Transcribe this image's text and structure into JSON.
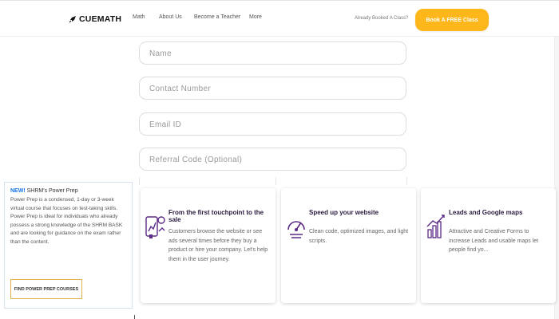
{
  "header": {
    "logo_text": "CUEMATH",
    "nav": [
      "Math",
      "About Us",
      "Become a Teacher",
      "More"
    ],
    "already_booked": "Already Booked A Class?",
    "book_button": "Book A FREE Class"
  },
  "form": {
    "name_placeholder": "Name",
    "contact_placeholder": "Contact Number",
    "email_placeholder": "Email ID",
    "referral_placeholder": "Referral Code (Optional)"
  },
  "promo": {
    "new_label": "NEW!",
    "title": " SHRM's Power Prep",
    "body": "Power Prep is a condensed, 1-day or 3-week virtual course that focuses on test-taking skills. Power Prep is ideal for individuals who already possess a strong knowledge of the SHRM BASK and are looking for guidance on the exam rather than the content.",
    "button": "FIND POWER PREP COURSES"
  },
  "cards": [
    {
      "icon": "touchpoint-analytics-icon",
      "title": "From the first touchpoint to the sale",
      "text": "Customers browse the website or see ads several times before they buy a product or hire your company. Let's help them in the user journey."
    },
    {
      "icon": "speed-gauge-icon",
      "title": "Speed up your website",
      "text": "Clean code, optimized images, and light scripts."
    },
    {
      "icon": "leads-growth-icon",
      "title": "Leads and Google maps",
      "text": "Attractive and Creative Forms to increase Leads and usable maps let people find yo..."
    }
  ],
  "colors": {
    "accent": "#fdb71a",
    "icon_purple": "#5b2a86",
    "new_blue": "#1a73e8"
  }
}
